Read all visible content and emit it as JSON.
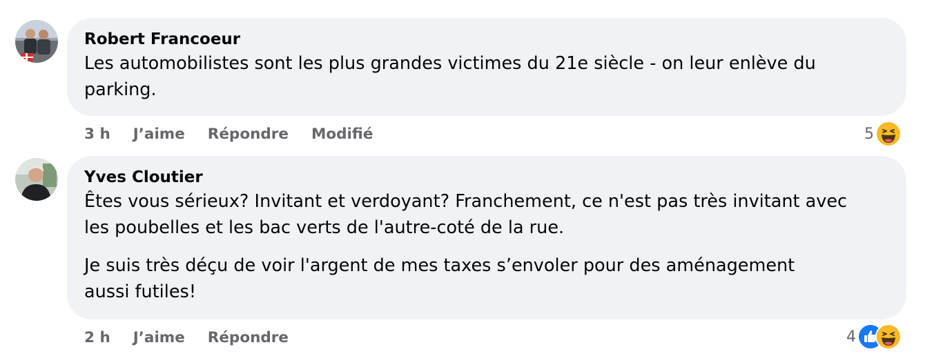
{
  "comments": [
    {
      "author": "Robert Francoeur",
      "paragraphs": [
        "Les automobilistes sont les plus grandes victimes du 21e siècle - on leur enlève du",
        "parking."
      ],
      "time": "3 h",
      "like_label": "J’aime",
      "reply_label": "Répondre",
      "edited_label": "Modifié",
      "reaction_count": "5",
      "reactions": [
        "haha-icon"
      ]
    },
    {
      "author": "Yves Cloutier",
      "paragraphs": [
        "Êtes vous sérieux? Invitant et verdoyant? Franchement, ce n'est pas très invitant avec",
        "les poubelles et les bac verts de l'autre-coté de la rue.",
        "Je suis très déçu de voir l'argent de mes taxes s’envoler pour des aménagement",
        "aussi futiles!"
      ],
      "time": "2 h",
      "like_label": "J’aime",
      "reply_label": "Répondre",
      "reaction_count": "4",
      "reactions": [
        "like-icon",
        "haha-icon"
      ]
    }
  ],
  "colors": {
    "bubble": "#f0f2f5",
    "text": "#050505",
    "secondary": "#65676b",
    "like_blue": "#1877f2",
    "haha_yellow": "#f7b928"
  }
}
